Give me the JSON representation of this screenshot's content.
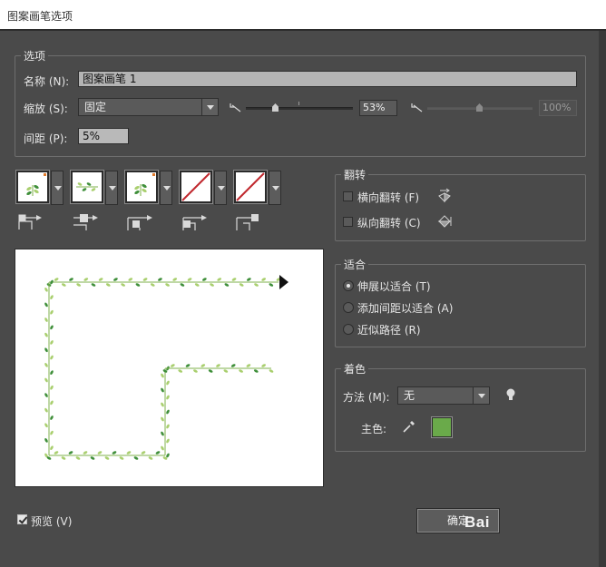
{
  "window": {
    "title": "图案画笔选项"
  },
  "options": {
    "group_title": "选项",
    "name_label": "名称 (N):",
    "name_value": "图案画笔 1",
    "scale_label": "缩放 (S):",
    "scale_mode": "固定",
    "scale_min_percent": "53%",
    "scale_max_percent": "100%",
    "spacing_label": "间距 (P):",
    "spacing_value": "5%"
  },
  "tiles": [
    {
      "name": "side-tile",
      "content": "vine"
    },
    {
      "name": "outer-corner-tile",
      "content": "vine"
    },
    {
      "name": "inner-corner-tile",
      "content": "vine"
    },
    {
      "name": "start-tile",
      "content": "none"
    },
    {
      "name": "end-tile",
      "content": "none"
    }
  ],
  "flip": {
    "group_title": "翻转",
    "horizontal_label": "横向翻转 (F)",
    "horizontal_checked": false,
    "vertical_label": "纵向翻转 (C)",
    "vertical_checked": false
  },
  "fit": {
    "group_title": "适合",
    "options": [
      {
        "label": "伸展以适合 (T)",
        "selected": true
      },
      {
        "label": "添加间距以适合 (A)",
        "selected": false
      },
      {
        "label": "近似路径 (R)",
        "selected": false
      }
    ]
  },
  "colorization": {
    "group_title": "着色",
    "method_label": "方法 (M):",
    "method_value": "无",
    "key_color_label": "主色:",
    "key_color": "#6aaa4a"
  },
  "footer": {
    "preview_label": "预览 (V)",
    "preview_checked": true,
    "ok_label": "确定",
    "watermark": "Bai"
  },
  "colors": {
    "vine_leaf_light": "#a9cf6e",
    "vine_leaf_dark": "#3f8f3a",
    "vine_stem": "#7fb04c"
  }
}
